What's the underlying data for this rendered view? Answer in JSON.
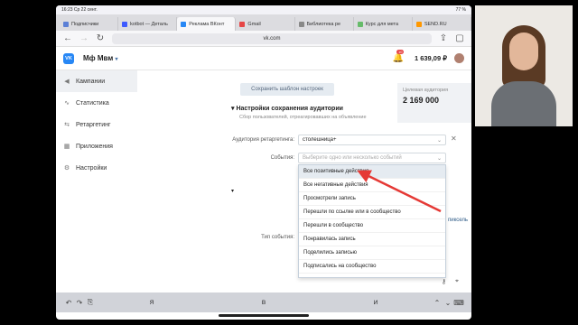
{
  "status": {
    "time": "16:23",
    "date": "Ср 22 сент.",
    "battery": "77 %"
  },
  "tabs": [
    {
      "label": "Подписчики",
      "color": "#5b7fd6",
      "active": false
    },
    {
      "label": "kotbot — Деталь",
      "color": "#3d5afe",
      "active": false
    },
    {
      "label": "Реклама ВКонт",
      "color": "#2787f5",
      "active": true
    },
    {
      "label": "Gmail",
      "color": "#e64646",
      "active": false
    },
    {
      "label": "Библиотека ре",
      "color": "#888888",
      "active": false
    },
    {
      "label": "Курс для мета",
      "color": "#66bb6a",
      "active": false
    },
    {
      "label": "SEND.RU",
      "color": "#ff9800",
      "active": false
    }
  ],
  "url": "vk.com",
  "header": {
    "logo": "VK",
    "account": "Мф Мвм",
    "notifications": "10",
    "balance": "1 639,09 ₽"
  },
  "sidebar": [
    {
      "label": "Кампании",
      "icon": "megaphone-icon",
      "glyph": "◀",
      "active": true
    },
    {
      "label": "Статистика",
      "icon": "chart-icon",
      "glyph": "∿",
      "active": false
    },
    {
      "label": "Ретаргетинг",
      "icon": "retarget-icon",
      "glyph": "⇆",
      "active": false
    },
    {
      "label": "Приложения",
      "icon": "apps-icon",
      "glyph": "▦",
      "active": false
    },
    {
      "label": "Настройки",
      "icon": "gear-icon",
      "glyph": "⚙",
      "active": false
    }
  ],
  "main": {
    "save_template": "Сохранить шаблон настроек",
    "section_title": "Настройки сохранения аудитории",
    "section_sub": "Сбор пользователей, отреагировавших на объявление",
    "audience_label": "Аудитория ретаргетинга:",
    "audience_value": "столешница+",
    "events_label": "События:",
    "events_placeholder": "Выберите одно или несколько событий",
    "event_type_label": "Тип события:",
    "pixel_link": "пиксель",
    "size_title": "Целевая аудитория",
    "size_value": "2 169 000"
  },
  "dropdown": [
    "Все позитивные действия",
    "Все негативные действия",
    "Просмотрели запись",
    "Перешли по ссылке или в сообщество",
    "Перешли в сообщество",
    "Понравилась запись",
    "Поделились записью",
    "Подписались на сообщество"
  ],
  "keyboard": {
    "suggestions": [
      "Я",
      "В",
      "И"
    ]
  }
}
